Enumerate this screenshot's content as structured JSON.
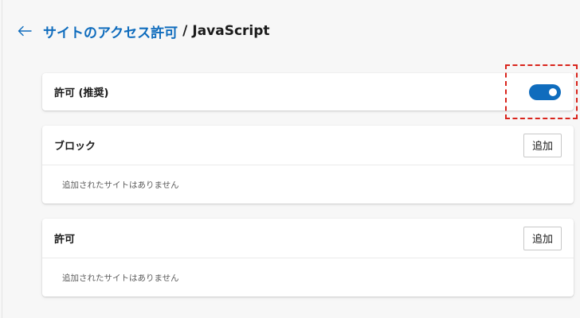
{
  "header": {
    "back_icon": "arrow-left-icon",
    "parent": "サイトのアクセス許可",
    "separator": "/",
    "current": "JavaScript"
  },
  "allow_toggle": {
    "label": "許可 (推奨)",
    "state": "on",
    "accent_color": "#0f6cbd"
  },
  "block_section": {
    "title": "ブロック",
    "add_label": "追加",
    "empty_message": "追加されたサイトはありません"
  },
  "allow_section": {
    "title": "許可",
    "add_label": "追加",
    "empty_message": "追加されたサイトはありません"
  },
  "highlight_color": "#d9241c"
}
